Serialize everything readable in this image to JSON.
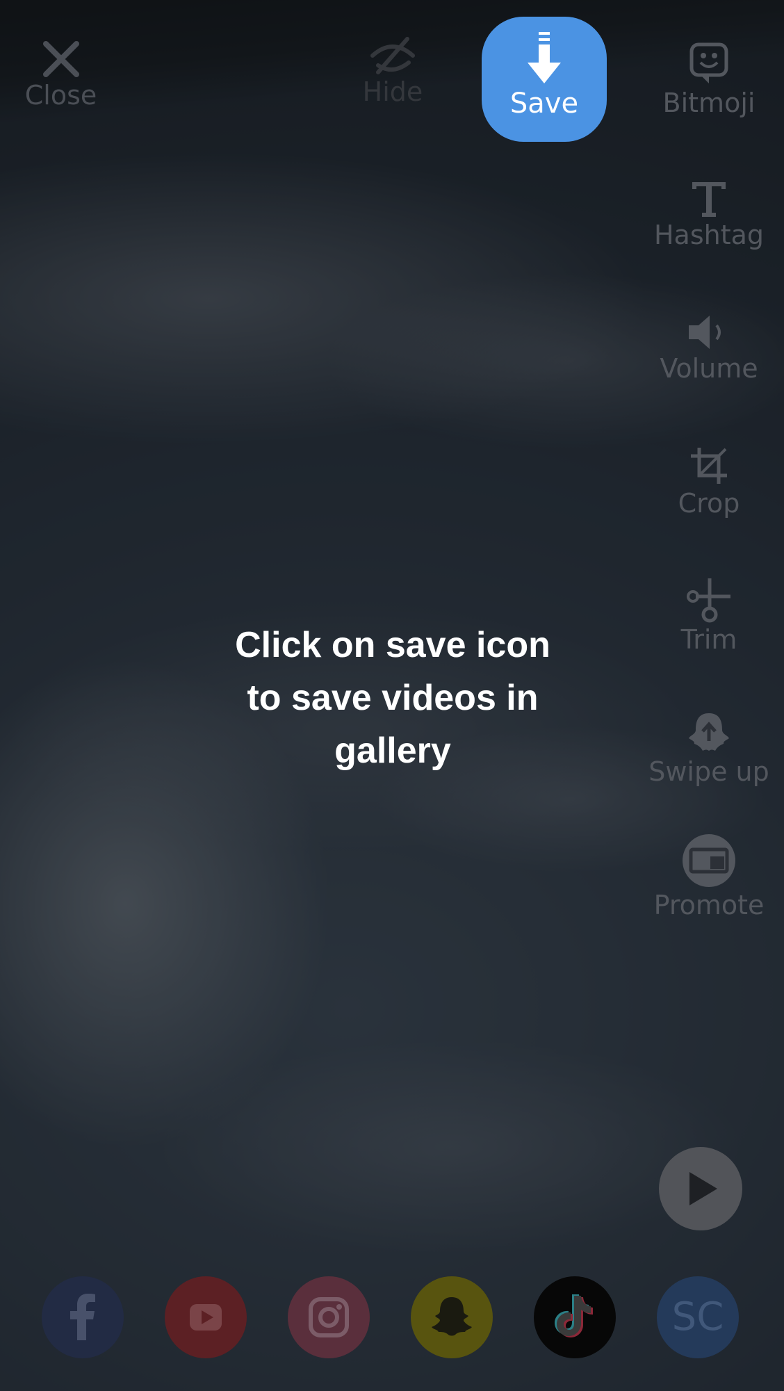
{
  "top_bar": {
    "close_label": "Close",
    "hide_label": "Hide",
    "save_label": "Save"
  },
  "tools": [
    {
      "label": "Bitmoji",
      "icon": "bitmoji-icon"
    },
    {
      "label": "Hashtag",
      "icon": "text-t-icon"
    },
    {
      "label": "Volume",
      "icon": "speaker-icon"
    },
    {
      "label": "Crop",
      "icon": "crop-icon"
    },
    {
      "label": "Trim",
      "icon": "scissors-icon"
    },
    {
      "label": "Swipe up",
      "icon": "ghost-upload-icon"
    },
    {
      "label": "Promote",
      "icon": "promote-icon"
    }
  ],
  "message": {
    "line1": "Click on save icon",
    "line2": "to save videos in",
    "line3": "gallery"
  },
  "share": [
    {
      "name": "facebook",
      "icon": "facebook-icon"
    },
    {
      "name": "youtube",
      "icon": "youtube-icon"
    },
    {
      "name": "instagram",
      "icon": "instagram-icon"
    },
    {
      "name": "snapchat",
      "icon": "snapchat-icon"
    },
    {
      "name": "tiktok",
      "icon": "tiktok-icon"
    },
    {
      "name": "sc",
      "icon": "sc-icon",
      "label": "SC"
    }
  ],
  "colors": {
    "save_accent": "#4b93e3",
    "overlay_text": "#ffffff"
  }
}
